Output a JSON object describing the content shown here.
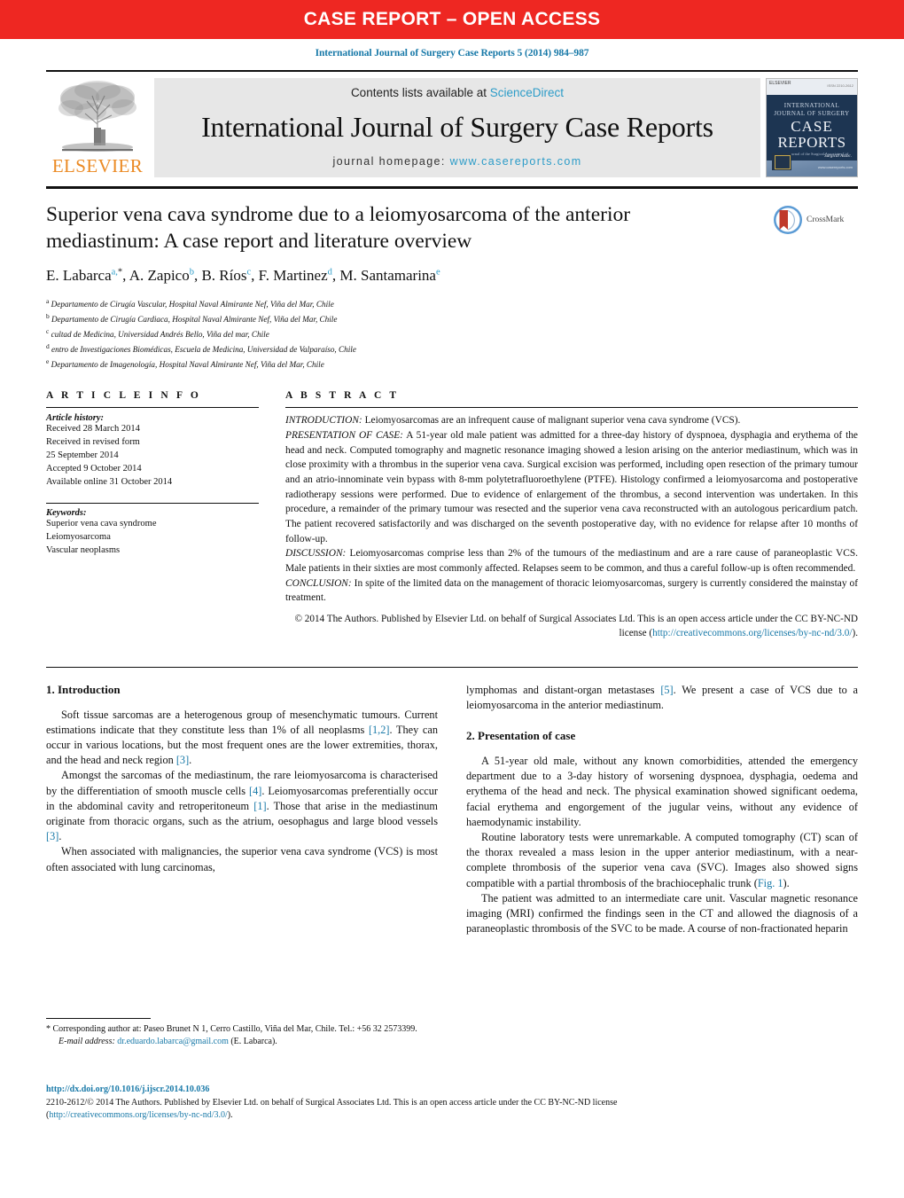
{
  "banner": {
    "text": "CASE REPORT – OPEN ACCESS"
  },
  "running_head": "International Journal of Surgery Case Reports 5 (2014) 984–987",
  "masthead": {
    "contents_prefix": "Contents lists available at ",
    "sciencedirect": "ScienceDirect",
    "journal_title": "International Journal of Surgery Case Reports",
    "homepage_prefix": "journal homepage: ",
    "homepage_url": "www.casereports.com",
    "elsevier_wordmark": "ELSEVIER",
    "cover": {
      "publisher": "ELSEVIER",
      "issn": "ISSN 2210-2612",
      "line1": "INTERNATIONAL",
      "line2": "JOURNAL OF SURGERY",
      "case": "CASE",
      "reports": "REPORTS",
      "subtitle": "Official journal of the Surgical Associates Ltd",
      "badge": "Surgical Assoc.",
      "url": "www.casereports.com"
    }
  },
  "article": {
    "title": "Superior vena cava syndrome due to a leiomyosarcoma of the anterior mediastinum: A case report and literature overview",
    "crossmark_label": "CrossMark",
    "authors": [
      {
        "name": "E. Labarca",
        "sup": "a,",
        "star": "*"
      },
      {
        "name": "A. Zapico",
        "sup": "b"
      },
      {
        "name": "B. Ríos",
        "sup": "c"
      },
      {
        "name": "F. Martinez",
        "sup": "d"
      },
      {
        "name": "M. Santamarina",
        "sup": "e"
      }
    ],
    "affiliations": [
      {
        "mark": "a",
        "text": "Departamento de Cirugía Vascular, Hospital Naval Almirante Nef, Viña del Mar, Chile"
      },
      {
        "mark": "b",
        "text": "Departamento de Cirugía Cardiaca, Hospital Naval Almirante Nef, Viña del Mar, Chile"
      },
      {
        "mark": "c",
        "text": "cultad de Medicina, Universidad Andrés Bello, Viña del mar, Chile"
      },
      {
        "mark": "d",
        "text": "entro de Investigaciones Biomédicas, Escuela de Medicina, Universidad de Valparaíso, Chile"
      },
      {
        "mark": "e",
        "text": "Departamento de Imagenología, Hospital Naval Almirante Nef, Viña del Mar, Chile"
      }
    ]
  },
  "article_info": {
    "heading": "A R T I C L E   I N F O",
    "history_label": "Article history:",
    "history": [
      "Received 28 March 2014",
      "Received in revised form",
      "25 September 2014",
      "Accepted 9 October 2014",
      "Available online 31 October 2014"
    ],
    "keywords_label": "Keywords:",
    "keywords": [
      "Superior vena cava syndrome",
      "Leiomyosarcoma",
      "Vascular neoplasms"
    ]
  },
  "abstract": {
    "heading": "A B S T R A C T",
    "sections": [
      {
        "lead": "INTRODUCTION:",
        "text": " Leiomyosarcomas are an infrequent cause of malignant superior vena cava syndrome (VCS)."
      },
      {
        "lead": "PRESENTATION OF CASE:",
        "text": " A 51-year old male patient was admitted for a three-day history of dyspnoea, dysphagia and erythema of the head and neck. Computed tomography and magnetic resonance imaging showed a lesion arising on the anterior mediastinum, which was in close proximity with a thrombus in the superior vena cava. Surgical excision was performed, including open resection of the primary tumour and an atrio-innominate vein bypass with 8-mm polytetrafluoroethylene (PTFE). Histology confirmed a leiomyosarcoma and postoperative radiotherapy sessions were performed. Due to evidence of enlargement of the thrombus, a second intervention was undertaken. In this procedure, a remainder of the primary tumour was resected and the superior vena cava reconstructed with an autologous pericardium patch. The patient recovered satisfactorily and was discharged on the seventh postoperative day, with no evidence for relapse after 10 months of follow-up."
      },
      {
        "lead": "DISCUSSION:",
        "text": " Leiomyosarcomas comprise less than 2% of the tumours of the mediastinum and are a rare cause of paraneoplastic VCS. Male patients in their sixties are most commonly affected. Relapses seem to be common, and thus a careful follow-up is often recommended."
      },
      {
        "lead": "CONCLUSION:",
        "text": " In spite of the limited data on the management of thoracic leiomyosarcomas, surgery is currently considered the mainstay of treatment."
      }
    ],
    "copyright_prefix": "© 2014 The Authors. Published by Elsevier Ltd. on behalf of Surgical Associates Ltd. This is an open access article under the CC BY-NC-ND license (",
    "copyright_link": "http://creativecommons.org/licenses/by-nc-nd/3.0/",
    "copyright_suffix": ")."
  },
  "body": {
    "left": {
      "heading1": "1.  Introduction",
      "p1_a": "Soft tissue sarcomas are a heterogenous group of mesenchymatic tumours. Current estimations indicate that they constitute less than 1% of all neoplasms ",
      "ref12": "[1,2]",
      "p1_b": ". They can occur in various locations, but the most frequent ones are the lower extremities, thorax, and the head and neck region ",
      "ref3a": "[3]",
      "p1_c": ".",
      "p2_a": "Amongst the sarcomas of the mediastinum, the rare leiomyosarcoma is characterised by the differentiation of smooth muscle cells ",
      "ref4": "[4]",
      "p2_b": ". Leiomyosarcomas preferentially occur in the abdominal cavity and retroperitoneum ",
      "ref1": "[1]",
      "p2_c": ". Those that arise in the mediastinum originate from thoracic organs, such as the atrium, oesophagus and large blood vessels ",
      "ref3b": "[3]",
      "p2_d": ".",
      "p3": "When associated with malignancies, the superior vena cava syndrome (VCS) is most often associated with lung carcinomas,"
    },
    "right": {
      "p1_a": "lymphomas and distant-organ metastases ",
      "ref5": "[5]",
      "p1_b": ". We present a case of VCS due to a leiomyosarcoma in the anterior mediastinum.",
      "heading2": "2.  Presentation of case",
      "p2": "A 51-year old male, without any known comorbidities, attended the emergency department due to a 3-day history of worsening dyspnoea, dysphagia, oedema and erythema of the head and neck. The physical examination showed significant oedema, facial erythema and engorgement of the jugular veins, without any evidence of haemodynamic instability.",
      "p3_a": "Routine laboratory tests were unremarkable. A computed tomography (CT) scan of the thorax revealed a mass lesion in the upper anterior mediastinum, with a near-complete thrombosis of the superior vena cava (SVC). Images also showed signs compatible with a partial thrombosis of the brachiocephalic trunk (",
      "figref": "Fig. 1",
      "p3_b": ").",
      "p4": "The patient was admitted to an intermediate care unit. Vascular magnetic resonance imaging (MRI) confirmed the findings seen in the CT and allowed the diagnosis of a paraneoplastic thrombosis of the SVC to be made. A course of non-fractionated heparin"
    }
  },
  "footnote": {
    "star": "*",
    "corresponding": " Corresponding author at: Paseo Brunet N 1, Cerro Castillo, Viña del Mar, Chile. Tel.: +56 32 2573399.",
    "email_label": "E-mail address:",
    "email": "dr.eduardo.labarca@gmail.com",
    "email_tail": " (E. Labarca)."
  },
  "page_footer": {
    "doi": "http://dx.doi.org/10.1016/j.ijscr.2014.10.036",
    "line1": "2210-2612/© 2014 The Authors. Published by Elsevier Ltd. on behalf of Surgical Associates Ltd. This is an open access article under the CC BY-NC-ND license",
    "line2_open": "(",
    "line2_link": "http://creativecommons.org/licenses/by-nc-nd/3.0/",
    "line2_close": ")."
  },
  "colors": {
    "banner_red": "#ee2722",
    "link_blue": "#1879a8",
    "sd_blue": "#2c9cc8",
    "elsevier_orange": "#eb8a24",
    "masthead_gray": "#e7e7e7"
  }
}
